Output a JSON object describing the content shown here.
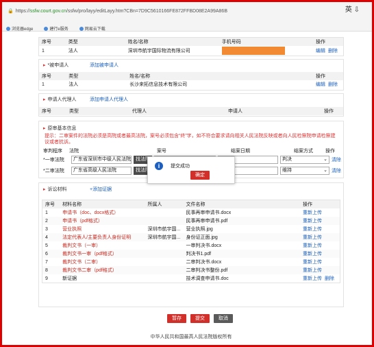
{
  "browser": {
    "url_host": "ssfw.court.gov.cn",
    "url_path": "/ssfw/pro/layy/editLayy.htm?CBn=7D9C5610166FE872FFBD08E2A99A86B",
    "right_text": "英 ⇩",
    "bookmarks": [
      "浏览器edge",
      "建行e服务",
      "网易云下载"
    ]
  },
  "plaintiff": {
    "headers": [
      "序号",
      "类型",
      "姓名/名称",
      "手机号码",
      "操作"
    ],
    "row": {
      "no": "1",
      "type": "法人",
      "name": "深圳市航宇国际物流有限公司",
      "edit": "编辑",
      "delete": "删除"
    }
  },
  "defendant": {
    "title": "*被申请人",
    "add_link": "添加被申请人",
    "headers": [
      "序号",
      "类型",
      "姓名/名称",
      "操作"
    ],
    "row": {
      "no": "1",
      "type": "法人",
      "name": "长沙来拓信息技术有限公司",
      "edit": "编辑",
      "delete": "删除"
    }
  },
  "agent": {
    "title": "申请人代理人",
    "add_link": "添加申请人代理人",
    "headers": [
      "序号",
      "类型",
      "代理人",
      "申请人",
      "操作"
    ]
  },
  "case_info": {
    "title": "原审基本信息",
    "hint": "提示：二审案件的法院必须是高院或者最高法院，案号必须包含“终”字，如不符合要求请向相关人民法院反映或者向人民检察院申请检察建议或者抗诉。",
    "headers": [
      "审判程序",
      "法院",
      "案号",
      "结案日期",
      "结案方式",
      "操作"
    ],
    "row1": {
      "level": "一审法院",
      "court": "广东省深圳市中级人民法院",
      "find": "找法院",
      "method": "判决",
      "clear": "清除"
    },
    "row2": {
      "level": "二审法院",
      "court": "广东省高级人民法院",
      "find": "找法院",
      "method": "维持",
      "clear": "清除"
    }
  },
  "evidence": {
    "title": "诉讼材料",
    "add_link": "+添加证据",
    "headers": [
      "序号",
      "材料名称",
      "所属人",
      "文件名称",
      "操作"
    ],
    "rows": [
      {
        "no": "1",
        "name": "申请书（doc、docx格式）",
        "owner": "",
        "file": "民事再审申请书.docx",
        "op": "重新上传",
        "red": true
      },
      {
        "no": "2",
        "name": "申请书（pdf格式）",
        "owner": "",
        "file": "民事再审申请书.pdf",
        "op": "重新上传",
        "red": true
      },
      {
        "no": "3",
        "name": "营业执照",
        "owner": "深圳市航宇国...",
        "file": "营业执照.jpg",
        "op": "重新上传",
        "red": true
      },
      {
        "no": "4",
        "name": "法定代表人/主要负责人身份证明",
        "owner": "深圳市航宇国...",
        "file": "身份证正面.jpg",
        "op": "重新上传",
        "red": true
      },
      {
        "no": "5",
        "name": "裁判文书（一审）",
        "owner": "",
        "file": "一审判决书.docx",
        "op": "重新上传",
        "red": true
      },
      {
        "no": "6",
        "name": "裁判文书一审（pdf格式）",
        "owner": "",
        "file": "判决书1.pdf",
        "op": "重新上传",
        "red": true
      },
      {
        "no": "7",
        "name": "裁判文书（二审）",
        "owner": "",
        "file": "二审判决书.docx",
        "op": "重新上传",
        "red": true
      },
      {
        "no": "8",
        "name": "裁判文书二审（pdf格式）",
        "owner": "",
        "file": "二审判决书整份.pdf",
        "op": "重新上传",
        "red": true
      },
      {
        "no": "9",
        "name": "新证据",
        "owner": "",
        "file": "技术调查申请书.doc",
        "op": "重新上传",
        "op2": "删除",
        "red": false
      }
    ]
  },
  "actions": {
    "save": "暂存",
    "submit": "提交",
    "cancel": "取消"
  },
  "modal": {
    "message": "提交成功",
    "ok": "确定"
  },
  "footer": "中华人民共和国最高人民法院版权所有",
  "colors": {
    "accent_red": "#d1302a",
    "link_blue": "#1b5fb9",
    "frame_red": "#e00000",
    "mask_orange": "#f28a33"
  }
}
